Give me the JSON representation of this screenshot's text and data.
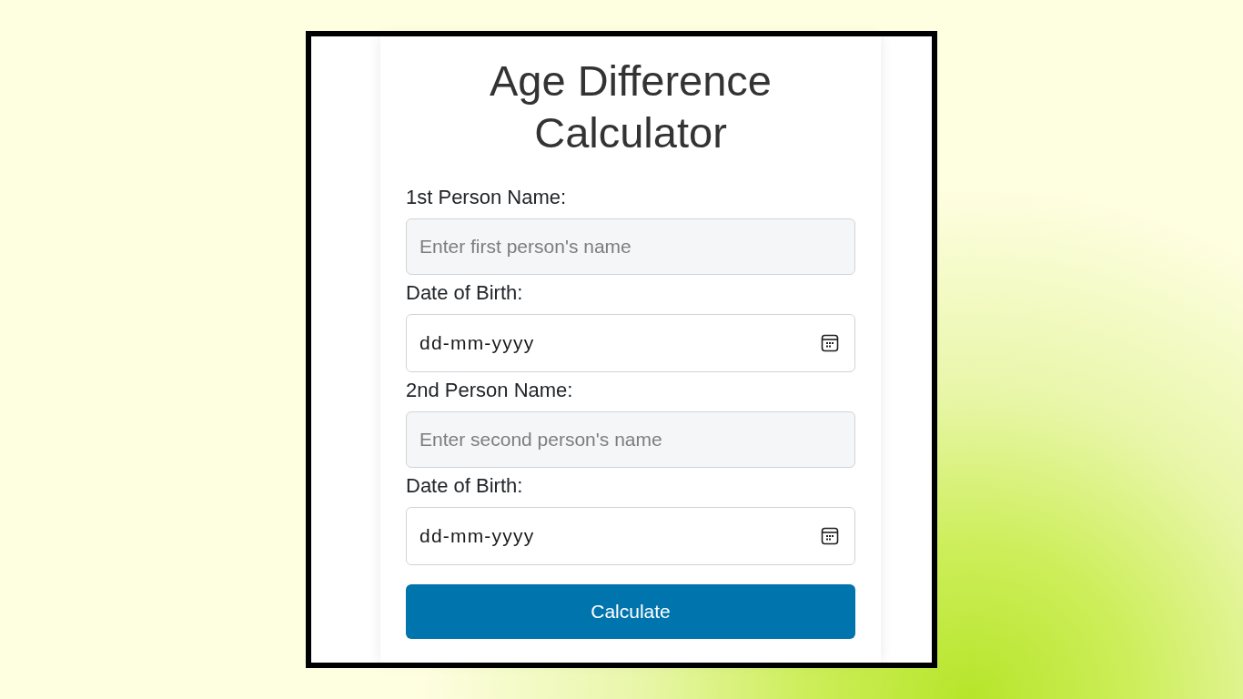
{
  "title": "Age Difference Calculator",
  "fields": [
    {
      "label": "1st Person Name:",
      "kind": "text",
      "placeholder": "Enter first person's name"
    },
    {
      "label": "Date of Birth:",
      "kind": "date",
      "placeholder": "dd-mm-yyyy"
    },
    {
      "label": "2nd Person Name:",
      "kind": "text",
      "placeholder": "Enter second person's name"
    },
    {
      "label": "Date of Birth:",
      "kind": "date",
      "placeholder": "dd-mm-yyyy"
    }
  ],
  "button": "Calculate"
}
